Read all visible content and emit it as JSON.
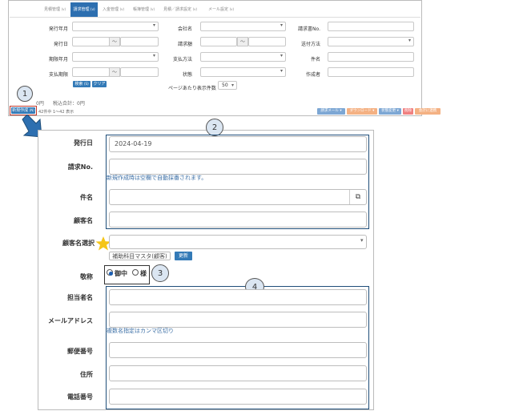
{
  "tabs": [
    {
      "label": "見積管理",
      "badge": "(v)"
    },
    {
      "label": "請求管理",
      "badge": "(v)"
    },
    {
      "label": "入金管理",
      "badge": "(v)"
    },
    {
      "label": "帳簿管理",
      "badge": "(v)"
    },
    {
      "label": "見積／請求設定",
      "badge": "(v)"
    },
    {
      "label": "メール設定",
      "badge": "(v)"
    }
  ],
  "search": {
    "issue_month": "発行年月",
    "issue_date": "発行日",
    "due_month": "期限年月",
    "pay_due_date": "支払期限",
    "company": "会社名",
    "amount": "請求額",
    "pay_method": "支払方法",
    "status": "状態",
    "invoice_no": "請求書No.",
    "send_method": "送付方法",
    "subject": "件名",
    "creator": "作成者",
    "tilde": "〜",
    "search_btn": "検索",
    "search_badge": "(S)",
    "clear_btn": "クリア",
    "per_page_label": "ページあたり表示件数",
    "per_page_value": "50"
  },
  "summary": {
    "total": "0円",
    "tax_total": "税込合計：0円",
    "new_btn": "新規作成",
    "new_badge": "(N)",
    "count": "42件中 1〜42 表示"
  },
  "action_tags": [
    {
      "label": "請求メール",
      "color": "#7da7d4"
    },
    {
      "label": "ダウンロード",
      "color": "#f4b183"
    },
    {
      "label": "状態変更",
      "color": "#7da7d4"
    },
    {
      "label": "削除",
      "color": "#f08080"
    },
    {
      "label": "会計に連携",
      "color": "#f4b183"
    }
  ],
  "form": {
    "issue_date_label": "発行日",
    "issue_date_value": "2024-04-19",
    "invoice_no_label": "請求No.",
    "invoice_no_hint": "新規作成時は空欄で自動採番されます。",
    "subject_label": "件名",
    "customer_label": "顧客名",
    "customer_select_label": "顧客名選択",
    "subaccount_btn": "補助科目マスタ(顧客)",
    "update_btn": "更新",
    "honorific_label": "敬称",
    "honorific_opt1": "御中",
    "honorific_opt2": "様",
    "contact_label": "担当者名",
    "email_label": "メールアドレス",
    "email_hint": "複数名指定はカンマ区切り",
    "zip_label": "郵便番号",
    "address_label": "住所",
    "phone_label": "電話番号"
  },
  "callouts": {
    "c1": "1",
    "c2": "2",
    "c3": "3",
    "c4": "4"
  },
  "colors": {
    "accent": "#2d6fb0",
    "highlight": "#1f4e79",
    "callout": "#dbe6f2",
    "star": "#f5c518"
  }
}
